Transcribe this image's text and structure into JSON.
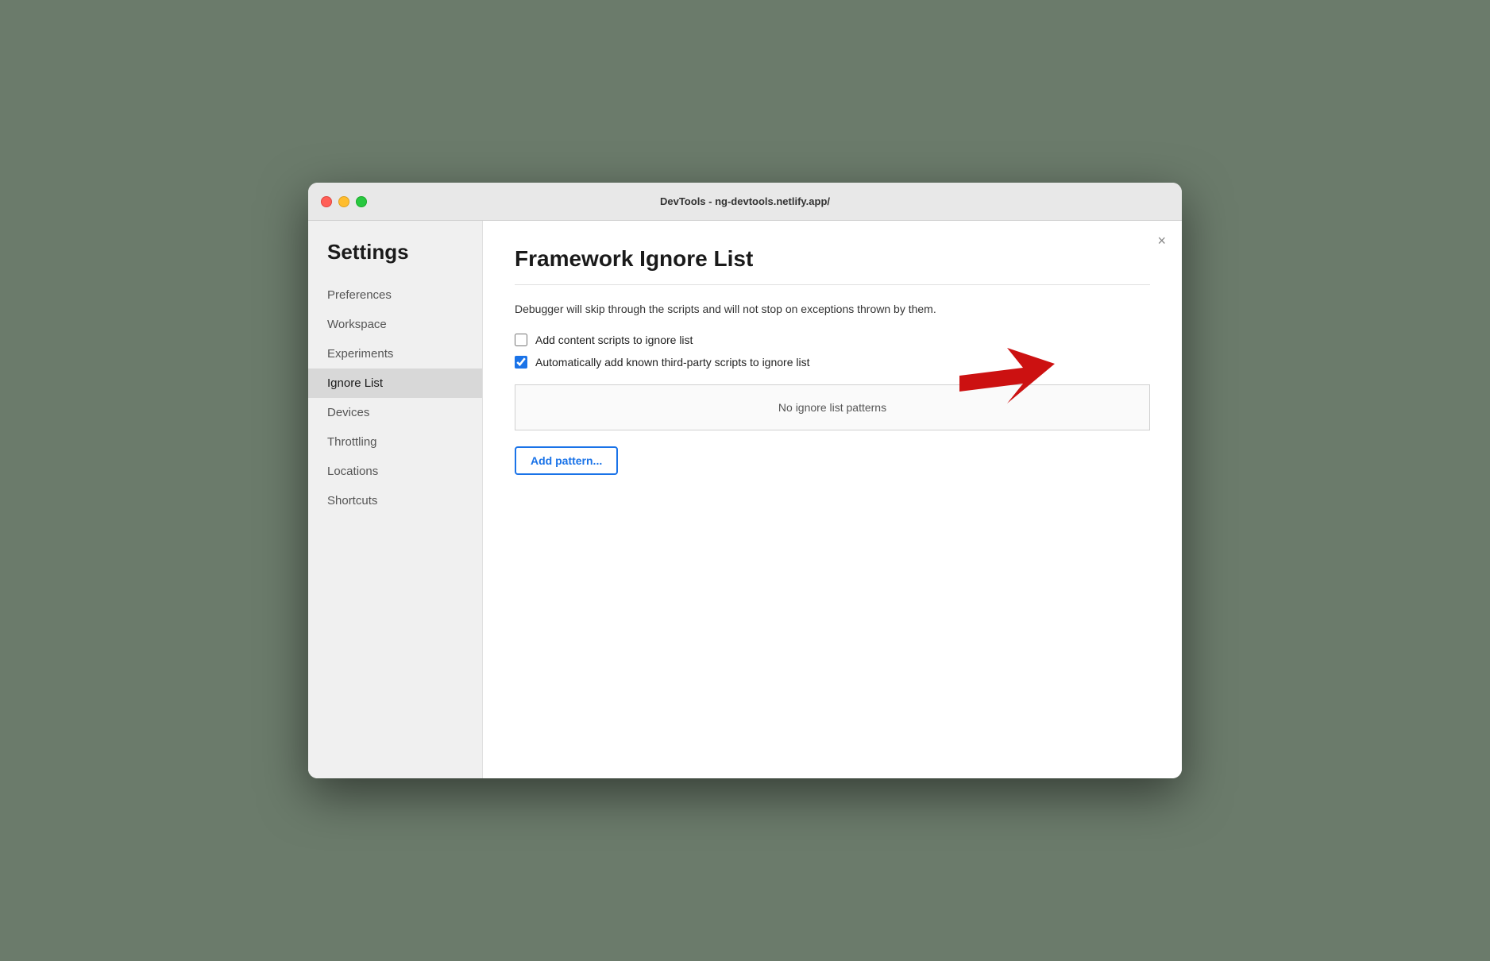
{
  "window": {
    "title": "DevTools - ng-devtools.netlify.app/"
  },
  "sidebar": {
    "heading": "Settings",
    "items": [
      {
        "id": "preferences",
        "label": "Preferences",
        "active": false
      },
      {
        "id": "workspace",
        "label": "Workspace",
        "active": false
      },
      {
        "id": "experiments",
        "label": "Experiments",
        "active": false
      },
      {
        "id": "ignore-list",
        "label": "Ignore List",
        "active": true
      },
      {
        "id": "devices",
        "label": "Devices",
        "active": false
      },
      {
        "id": "throttling",
        "label": "Throttling",
        "active": false
      },
      {
        "id": "locations",
        "label": "Locations",
        "active": false
      },
      {
        "id": "shortcuts",
        "label": "Shortcuts",
        "active": false
      }
    ]
  },
  "main": {
    "title": "Framework Ignore List",
    "description": "Debugger will skip through the scripts and will not stop on exceptions thrown by them.",
    "checkboxes": [
      {
        "id": "add-content-scripts",
        "label": "Add content scripts to ignore list",
        "checked": false
      },
      {
        "id": "auto-add-third-party",
        "label": "Automatically add known third-party scripts to ignore list",
        "checked": true
      }
    ],
    "patterns_placeholder": "No ignore list patterns",
    "add_pattern_label": "Add pattern...",
    "close_label": "×"
  }
}
